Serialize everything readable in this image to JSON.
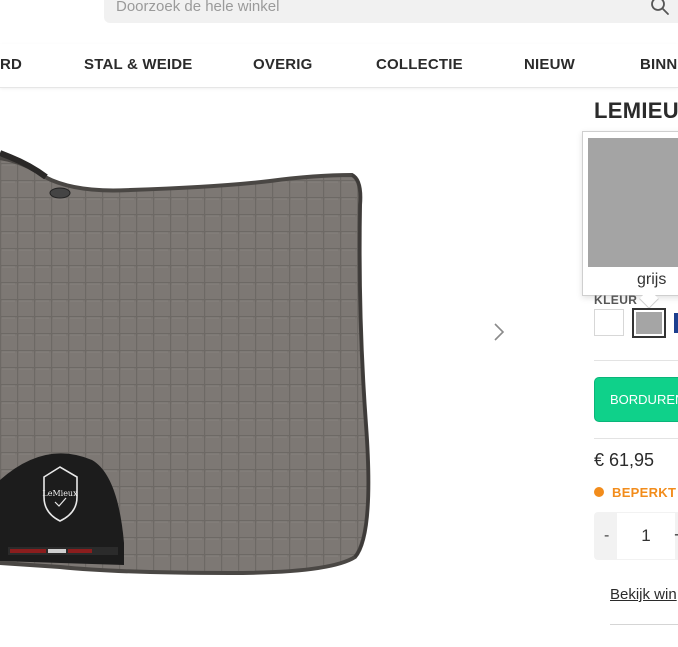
{
  "search": {
    "placeholder": "Doorzoek de hele winkel"
  },
  "nav": {
    "items": [
      {
        "label": "RD"
      },
      {
        "label": "STAL & WEIDE"
      },
      {
        "label": "OVERIG"
      },
      {
        "label": "COLLECTIE"
      },
      {
        "label": "NIEUW"
      },
      {
        "label": "BINN"
      }
    ]
  },
  "product": {
    "title": "LEMIEUX",
    "logo_text": "LeMieux",
    "color_label": "KLEUR",
    "selected_color": "grijs",
    "embroider_label": "BORDUREN",
    "price": "€ 61,95",
    "stock_status": "BEPERKT O",
    "quantity": "1",
    "qty_minus": "-",
    "qty_plus": "+",
    "stores_link": "Bekijk win"
  },
  "colors": {
    "pad_grey": "#7c7773",
    "swatch_grey": "#a5a5a5",
    "swatch_navy": "#1c3f8f",
    "accent_green": "#0fd18a",
    "stock_orange": "#f28c1b"
  },
  "icons": [
    "search-icon",
    "chevron-right-icon",
    "lemieux-logo"
  ]
}
